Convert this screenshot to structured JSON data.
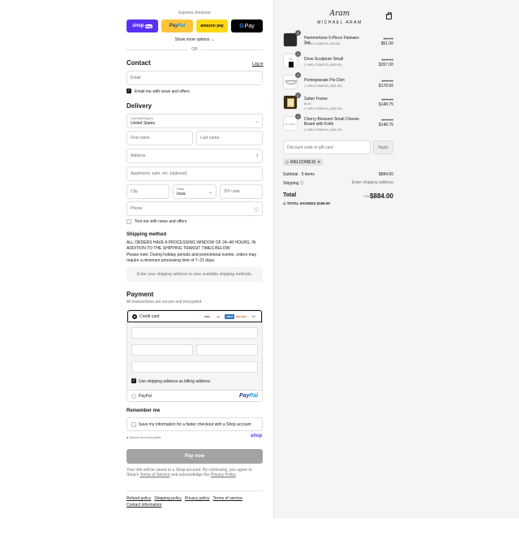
{
  "express": {
    "label": "Express checkout",
    "shop_pay": "shop",
    "shop_pay_pill": "Pay",
    "paypal_a": "Pay",
    "paypal_b": "Pal",
    "amazon": "amazon pay",
    "gpay_g": "G",
    "gpay": "Pay",
    "more": "Show more options ⌄",
    "or": "OR"
  },
  "contact": {
    "title": "Contact",
    "login": "Log in",
    "email_placeholder": "Email",
    "news_label": "Email me with news and offers"
  },
  "delivery": {
    "title": "Delivery",
    "country_label": "Country/Region",
    "country_value": "United States",
    "first_name": "First name",
    "last_name": "Last name",
    "address": "Address",
    "apartment": "Apartment, suite, etc. (optional)",
    "city": "City",
    "state_label": "State",
    "state_value": "Iowa",
    "zip": "ZIP code",
    "phone": "Phone",
    "text_label": "Text me with news and offers"
  },
  "shipping": {
    "title": "Shipping method",
    "notice_1": "ALL ORDERS HAVE A PROCESSING WINDOW OF 24–48 HOURS, IN ADDITION TO THE SHIPPING TRANSIT TIMES BELOW.",
    "notice_2": "Please note: During holiday periods and promotional events, orders may require a minimum processing time of 7–21 days.",
    "placeholder": "Enter your shipping address to view available shipping methods."
  },
  "payment": {
    "title": "Payment",
    "subtitle": "All transactions are secure and encrypted.",
    "credit_card": "Credit card",
    "more_cards": "+4",
    "billing_label": "Use shipping address as billing address",
    "paypal": "PayPal",
    "paypal_logo_a": "Pay",
    "paypal_logo_b": "Pal",
    "card_logos": [
      "VISA",
      "MC",
      "AMEX",
      "DISCOVER"
    ]
  },
  "remember": {
    "title": "Remember me",
    "label": "Save my information for a faster checkout with a Shop account",
    "secure": "Secure and encrypted",
    "shop": "shop"
  },
  "pay_now": "Pay now",
  "legal": {
    "text": "Your info will be saved to a Shop account. By continuing, you agree to Shop's",
    "terms": "Terms of Service",
    "and": "and acknowledge the",
    "privacy": "Privacy Policy",
    "end": "."
  },
  "footer": {
    "links": [
      "Refund policy",
      "Shipping policy",
      "Privacy policy",
      "Terms of service"
    ],
    "contact": "Contact information"
  },
  "brand": {
    "signature": "Aram",
    "name": "MICHAEL ARAM"
  },
  "cart": {
    "items": [
      {
        "qty": "1",
        "name": "Hammertone 5-Piece Flatware Set",
        "sub": "",
        "discount": "WELCOME15 (-$9.00)",
        "old": "$60.00",
        "price": "$51.00"
      },
      {
        "qty": "1",
        "name": "Dove Sculpture Small",
        "sub": "",
        "discount": "WELCOME15 (-$63.00)",
        "old": "$420.00",
        "price": "$357.00"
      },
      {
        "qty": "1",
        "name": "Pomegranate Pie Dish",
        "sub": "",
        "discount": "WELCOME15 (-$31.50)",
        "old": "$210.00",
        "price": "$178.50"
      },
      {
        "qty": "1",
        "name": "Safari Frame",
        "sub": "8x10",
        "discount": "WELCOME15 (-$26.25)",
        "old": "$175.00",
        "price": "$148.75"
      },
      {
        "qty": "1",
        "name": "Cherry Blossom Small Cheese Board with Knife",
        "sub": "",
        "discount": "WELCOME15 (-$26.25)",
        "old": "$175.00",
        "price": "$148.75"
      }
    ],
    "thumb_text": "ECLIPSE",
    "code_placeholder": "Discount code or gift card",
    "apply": "Apply",
    "tag": "WELCOME15",
    "subtotal_label": "Subtotal · 5 items",
    "subtotal": "$884.00",
    "shipping_label": "Shipping",
    "shipping_value": "Enter shipping address",
    "total_label": "Total",
    "currency": "USD",
    "total": "$884.00",
    "savings_label": "TOTAL SAVINGS",
    "savings": "$156.00"
  }
}
